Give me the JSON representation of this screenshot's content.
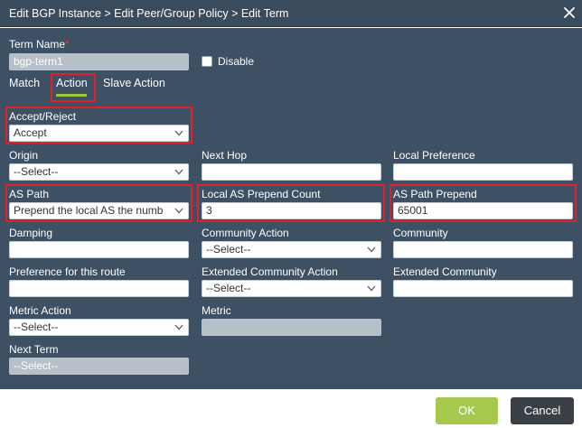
{
  "dialog": {
    "title": "Edit BGP Instance > Edit Peer/Group Policy > Edit Term"
  },
  "term_name": {
    "label": "Term Name",
    "required_mark": "*",
    "value": "bgp-term1"
  },
  "disable": {
    "label": "Disable",
    "checked": false
  },
  "tabs": [
    {
      "label": "Match",
      "active": false
    },
    {
      "label": "Action",
      "active": true
    },
    {
      "label": "Slave Action",
      "active": false
    }
  ],
  "fields": {
    "accept_reject": {
      "label": "Accept/Reject",
      "value": "Accept"
    },
    "origin": {
      "label": "Origin",
      "value": "--Select--"
    },
    "next_hop": {
      "label": "Next Hop",
      "value": ""
    },
    "local_preference": {
      "label": "Local Preference",
      "value": ""
    },
    "as_path": {
      "label": "AS Path",
      "value": "Prepend the local AS the numb"
    },
    "local_as_prepend_count": {
      "label": "Local AS Prepend Count",
      "value": "3"
    },
    "as_path_prepend": {
      "label": "AS Path Prepend",
      "value": "65001"
    },
    "damping": {
      "label": "Damping",
      "value": ""
    },
    "community_action": {
      "label": "Community Action",
      "value": "--Select--"
    },
    "community": {
      "label": "Community",
      "value": ""
    },
    "preference": {
      "label": "Preference for this route",
      "value": ""
    },
    "extended_community_action": {
      "label": "Extended Community Action",
      "value": "--Select--"
    },
    "extended_community": {
      "label": "Extended Community",
      "value": ""
    },
    "metric_action": {
      "label": "Metric Action",
      "value": "--Select--"
    },
    "metric": {
      "label": "Metric",
      "value": ""
    },
    "next_term": {
      "label": "Next Term",
      "value": "--Select--"
    }
  },
  "buttons": {
    "ok": "OK",
    "cancel": "Cancel"
  },
  "colors": {
    "titlebar": "#3a4b5e",
    "body": "#3e5164",
    "highlight": "#e0202a",
    "tab_underline": "#a4c639",
    "ok_button": "#a6c84c",
    "cancel_button": "#3a3f45"
  },
  "icons": {
    "close": "close-icon",
    "dropdown": "chevron-down-icon"
  }
}
